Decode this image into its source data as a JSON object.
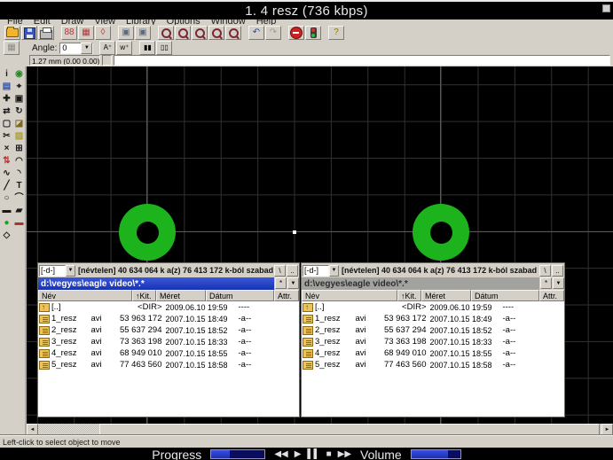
{
  "player": {
    "title": "1. 4 resz (736 kbps)",
    "progress_label": "Progress",
    "volume_label": "Volume",
    "progress_percent": 35,
    "volume_percent": 75,
    "bar_fill_color": "#2b3fd4",
    "bar_track_color": "#0a0d5e",
    "controls": {
      "rewind": "◀◀",
      "play": "▶",
      "pause": "▌▌",
      "stop": "■",
      "forward": "▶▶"
    }
  },
  "eagle": {
    "menu_items": [
      "File",
      "Edit",
      "Draw",
      "View",
      "Library",
      "Options",
      "Window",
      "Help"
    ],
    "toolbar2": {
      "angle_label": "Angle:",
      "angle_value": "0"
    },
    "coordbar": {
      "coords": "1.27 mm (0.00 0.00)",
      "command_value": ""
    },
    "statusbar_text": "Left-click to select object to move",
    "canvas": {
      "pad_color": "#1db31d",
      "grid_color": "#313131"
    },
    "toolbar1_buttons": [
      {
        "n": "open-file-icon",
        "cls": "i-folder",
        "g": ""
      },
      {
        "n": "save-file-icon",
        "cls": "i-floppy",
        "g": ""
      },
      {
        "n": "print-icon",
        "cls": "i-print",
        "g": ""
      },
      {
        "sep": true
      },
      {
        "n": "library-icon",
        "g": "88",
        "c": "#b03636"
      },
      {
        "n": "board-icon",
        "g": "▦",
        "c": "#b03636"
      },
      {
        "n": "device-icon",
        "g": "◊",
        "c": "#b03636"
      },
      {
        "sep": true
      },
      {
        "n": "fit-drawing-icon",
        "g": "▣",
        "c": "#5a6a7a"
      },
      {
        "n": "last-window-icon",
        "g": "▣",
        "c": "#5a6a7a"
      },
      {
        "sep": true
      },
      {
        "n": "zoom-fit-icon",
        "cls": "i-mag",
        "g": ""
      },
      {
        "n": "zoom-in-icon",
        "cls": "i-mag",
        "g": ""
      },
      {
        "n": "zoom-out-icon",
        "cls": "i-mag",
        "g": ""
      },
      {
        "n": "zoom-select-icon",
        "cls": "i-mag",
        "g": ""
      },
      {
        "n": "zoom-redraw-icon",
        "cls": "i-mag",
        "g": ""
      },
      {
        "sep": true
      },
      {
        "n": "undo-icon",
        "g": "↶",
        "c": "#2a4a9a"
      },
      {
        "n": "redo-icon",
        "g": "↷",
        "c": "#9a9a94"
      },
      {
        "sep": true
      },
      {
        "n": "stop-command-icon",
        "cls": "i-stopsign",
        "g": ""
      },
      {
        "n": "run-script-icon",
        "cls": "i-traffic",
        "g": ""
      },
      {
        "sep": true
      },
      {
        "n": "help-icon",
        "g": "?",
        "c": "#8a7a00"
      }
    ],
    "palette_tools": [
      {
        "n": "info-tool-icon",
        "g": "i",
        "c": "#1a1a1a"
      },
      {
        "n": "show-tool-icon",
        "g": "◉",
        "c": "#2a8a2a"
      },
      {
        "n": "display-tool-icon",
        "g": "▤",
        "c": "#2a50b0"
      },
      {
        "n": "mark-tool-icon",
        "g": "⌖",
        "c": "#1a1a1a"
      },
      {
        "n": "move-tool-icon",
        "g": "✚",
        "c": "#1a1a1a"
      },
      {
        "n": "copy-tool-icon",
        "g": "▣",
        "c": "#1a1a1a"
      },
      {
        "n": "mirror-tool-icon",
        "g": "⇄",
        "c": "#1a1a1a"
      },
      {
        "n": "rotate-tool-icon",
        "g": "↻",
        "c": "#1a1a1a"
      },
      {
        "n": "group-tool-icon",
        "g": "▢",
        "c": "#1a1a1a"
      },
      {
        "n": "change-tool-icon",
        "g": "◪",
        "c": "#7a6a20"
      },
      {
        "n": "cut-tool-icon",
        "g": "✂",
        "c": "#1a1a1a"
      },
      {
        "n": "paste-tool-icon",
        "g": "▨",
        "c": "#b0a020"
      },
      {
        "n": "delete-tool-icon",
        "g": "×",
        "c": "#1a1a1a"
      },
      {
        "n": "add-tool-icon",
        "g": "⊞",
        "c": "#1a1a1a"
      },
      {
        "n": "pinswap-tool-icon",
        "g": "⇅",
        "c": "#b03030"
      },
      {
        "n": "smash-tool-icon",
        "g": "◠",
        "c": "#1a1a1a"
      },
      {
        "n": "ratsnest-tool-icon",
        "g": "∿",
        "c": "#1a1a1a"
      },
      {
        "n": "split-tool-icon",
        "g": "◝",
        "c": "#1a1a1a"
      },
      {
        "n": "wire-tool-icon",
        "g": "╱",
        "c": "#1a1a1a"
      },
      {
        "n": "text-tool-icon",
        "g": "T",
        "c": "#1a1a1a"
      },
      {
        "n": "circle-tool-icon",
        "g": "○",
        "c": "#1a1a1a"
      },
      {
        "n": "arc-tool-icon",
        "g": "⌒",
        "c": "#1a1a1a"
      },
      {
        "n": "rect-tool-icon",
        "g": "▬",
        "c": "#1a1a1a"
      },
      {
        "n": "polygon-tool-icon",
        "g": "▰",
        "c": "#1a1a1a"
      },
      {
        "n": "via-tool-icon",
        "g": "●",
        "c": "#1f9f1f"
      },
      {
        "n": "signal-tool-icon",
        "g": "▬",
        "c": "#b03030"
      },
      {
        "n": "hole-tool-icon",
        "g": "◇",
        "c": "#1a1a1a"
      }
    ]
  },
  "panels": {
    "columns": [
      "Név",
      "↑Kit.",
      "Méret",
      "Dátum",
      "Attr."
    ],
    "left": {
      "drive": "[-d-]",
      "drive_info": "[névtelen]  40 634 064 k  a(z) 76 413 172 k-ból szabad",
      "root_button": "\\",
      "up_button": "..",
      "path": "d:\\vegyes\\eagle video\\*.*",
      "fav_button": "*",
      "history_button": "▼"
    },
    "right": {
      "drive": "[-d-]",
      "drive_info": "[névtelen]  40 634 064 k  a(z) 76 413 172 k-ból szabad",
      "root_button": "\\",
      "up_button": "..",
      "path": "d:\\vegyes\\eagle video\\*.*",
      "fav_button": "*",
      "history_button": "▼"
    },
    "rows": [
      {
        "icon": "up",
        "name": "[..]",
        "ext": "",
        "size": "<DIR>",
        "date": "2009.06.10 19:59",
        "attr": "----"
      },
      {
        "icon": "file",
        "name": "1_resz",
        "ext": "avi",
        "size": "53 963 172",
        "date": "2007.10.15 18:49",
        "attr": "-a--"
      },
      {
        "icon": "file",
        "name": "2_resz",
        "ext": "avi",
        "size": "55 637 294",
        "date": "2007.10.15 18:52",
        "attr": "-a--"
      },
      {
        "icon": "file",
        "name": "3_resz",
        "ext": "avi",
        "size": "73 363 198",
        "date": "2007.10.15 18:33",
        "attr": "-a--"
      },
      {
        "icon": "file",
        "name": "4_resz",
        "ext": "avi",
        "size": "68 949 010",
        "date": "2007.10.15 18:55",
        "attr": "-a--"
      },
      {
        "icon": "file",
        "name": "5_resz",
        "ext": "avi",
        "size": "77 463 560",
        "date": "2007.10.15 18:58",
        "attr": "-a--"
      }
    ]
  }
}
